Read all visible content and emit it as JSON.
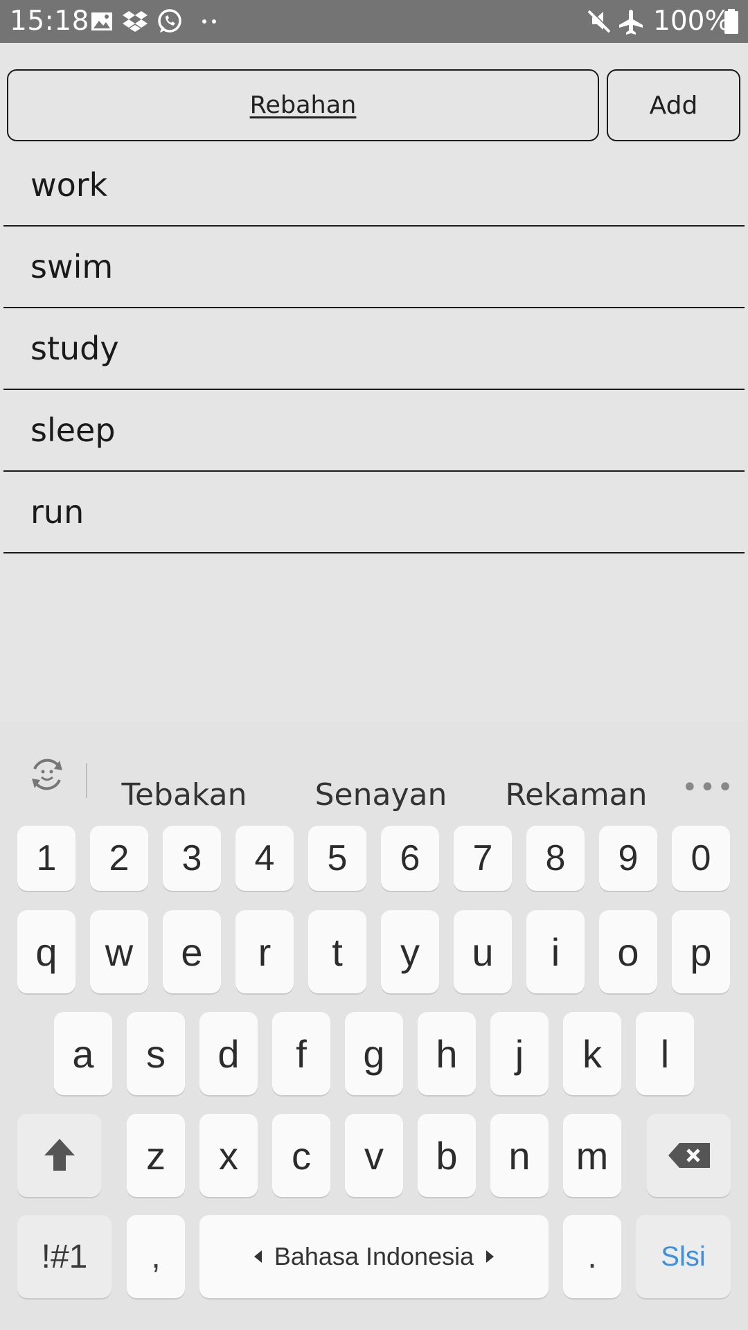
{
  "status_bar": {
    "time": "15:18",
    "battery": "100%",
    "icons": [
      "image-icon",
      "dropbox-icon",
      "whatsapp-icon",
      "more-dots-icon",
      "mute-icon",
      "airplane-icon",
      "battery-icon"
    ]
  },
  "form": {
    "input_value": "Rebahan",
    "add_label": "Add"
  },
  "list": {
    "items": [
      "work",
      "swim",
      "study",
      "sleep",
      "run"
    ]
  },
  "keyboard": {
    "suggestions": [
      "Tebakan",
      "Senayan",
      "Rekaman"
    ],
    "number_row": [
      "1",
      "2",
      "3",
      "4",
      "5",
      "6",
      "7",
      "8",
      "9",
      "0"
    ],
    "row1": [
      "q",
      "w",
      "e",
      "r",
      "t",
      "y",
      "u",
      "i",
      "o",
      "p"
    ],
    "row2": [
      "a",
      "s",
      "d",
      "f",
      "g",
      "h",
      "j",
      "k",
      "l"
    ],
    "row3": [
      "z",
      "x",
      "c",
      "v",
      "b",
      "n",
      "m"
    ],
    "symbols_label": "!#1",
    "comma_label": ",",
    "space_label": "Bahasa Indonesia",
    "period_label": ".",
    "enter_label": "Slsi",
    "accent_color": "#3d8fe0"
  }
}
